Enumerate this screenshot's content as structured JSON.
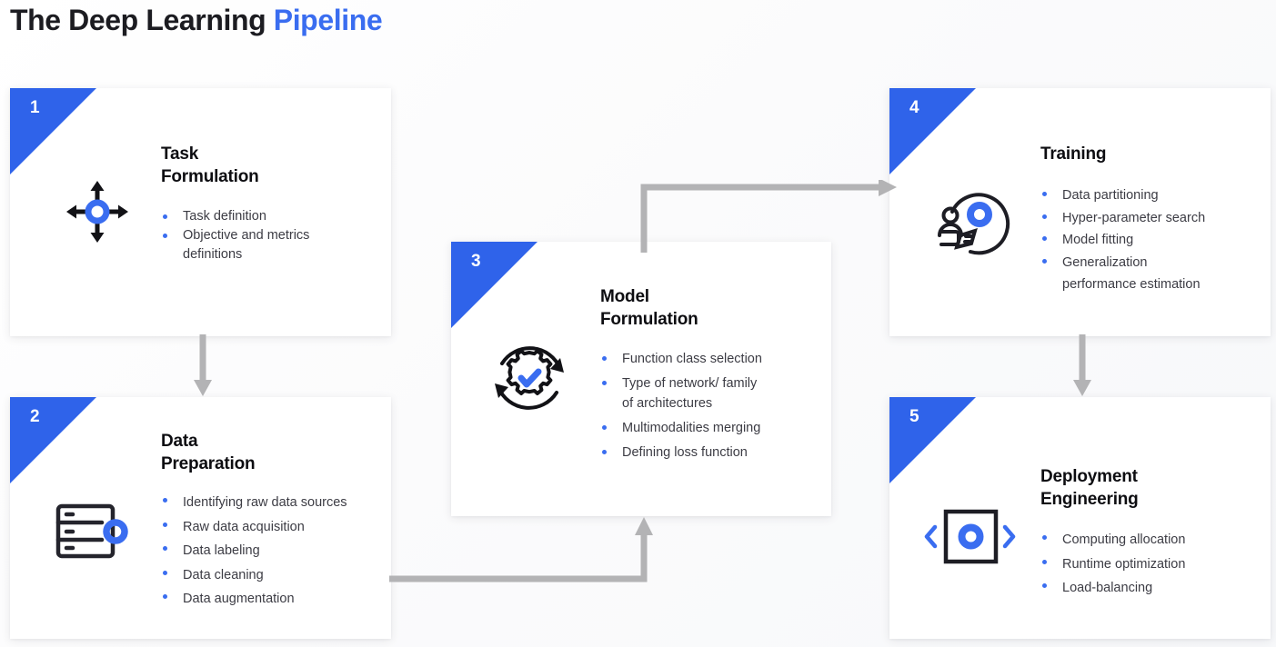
{
  "title": {
    "dark": "The Deep Learning ",
    "accent": "Pipeline"
  },
  "colors": {
    "accent": "#3a6df0",
    "corner": "#2f63ea",
    "ink": "#0d0d11",
    "body_text": "#3c3c44",
    "connector": "#b3b3b5",
    "card_bg": "#ffffff",
    "page_bg": "#ffffff"
  },
  "cards": [
    {
      "number": "1",
      "title": "Task\nFormulation",
      "icon": "four-direction-arrows-icon",
      "bullets": [
        "Task definition",
        "Objective and metrics\ndefinitions"
      ]
    },
    {
      "number": "2",
      "title": "Data\nPreparation",
      "icon": "database-server-icon",
      "bullets": [
        "Identifying raw data sources",
        "Raw data acquisition",
        "Data labeling",
        "Data cleaning",
        "Data augmentation"
      ]
    },
    {
      "number": "3",
      "title": "Model\nFormulation",
      "icon": "gear-check-refresh-icon",
      "bullets": [
        "Function class selection",
        "Type of network/ family\nof architectures",
        "Multimodalities merging",
        "Defining loss function"
      ]
    },
    {
      "number": "4",
      "title": "Training",
      "icon": "person-learning-icon",
      "bullets": [
        "Data partitioning",
        "Hyper-parameter search",
        "Model fitting",
        "Generalization\nperformance estimation"
      ]
    },
    {
      "number": "5",
      "title": "Deployment\nEngineering",
      "icon": "box-chevrons-icon",
      "bullets": [
        "Computing allocation",
        "Runtime optimization",
        "Load-balancing"
      ]
    }
  ],
  "connectors": [
    {
      "name": "arrow-card1-to-card2",
      "shape": "straight-down"
    },
    {
      "name": "arrow-card2-to-card3",
      "shape": "elbow-right-then-up"
    },
    {
      "name": "arrow-card3-to-card4",
      "shape": "elbow-up-then-right"
    },
    {
      "name": "arrow-card4-to-card5",
      "shape": "straight-down"
    }
  ]
}
